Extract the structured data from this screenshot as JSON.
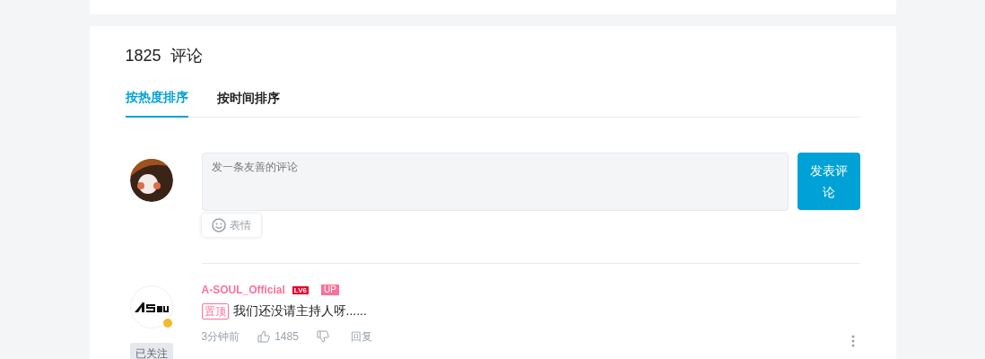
{
  "header": {
    "count": "1825",
    "title": "评论"
  },
  "tabs": [
    {
      "label": "按热度排序",
      "selected": true
    },
    {
      "label": "按时间排序",
      "selected": false
    }
  ],
  "composer": {
    "placeholder": "发一条友善的评论",
    "emoji_label": "表情",
    "submit": "发表评论"
  },
  "comments": [
    {
      "user": "A-SOUL_Official",
      "level": "LV6",
      "badge": "UP",
      "follow": "已关注",
      "pinned_tag": "置顶",
      "text": "我们还没请主持人呀......",
      "time": "3分钟前",
      "likes": "1485",
      "reply": "回复"
    }
  ]
}
